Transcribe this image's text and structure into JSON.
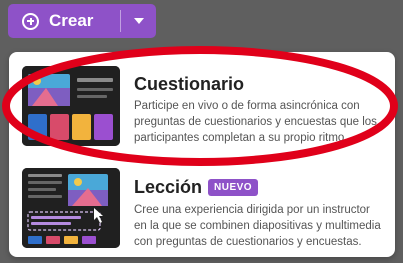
{
  "toolbar": {
    "create_label": "Crear",
    "create_icon": "plus-circle-icon",
    "dropdown_icon": "chevron-down-icon",
    "accent_color": "#8e52c8"
  },
  "menu": {
    "items": [
      {
        "title": "Cuestionario",
        "description": [
          "Participe en vivo o de forma asincrónica con",
          "preguntas de cuestionarios y encuestas que los",
          "participantes completan a su propio ritmo."
        ]
      },
      {
        "title": "Lección",
        "badge": "NUEVO",
        "description": [
          "Cree una experiencia dirigida por un instructor",
          "en la que se combinen diapositivas y multimedia",
          "con preguntas de cuestionarios y encuestas."
        ]
      }
    ]
  },
  "annotation_color": "#e0001a"
}
